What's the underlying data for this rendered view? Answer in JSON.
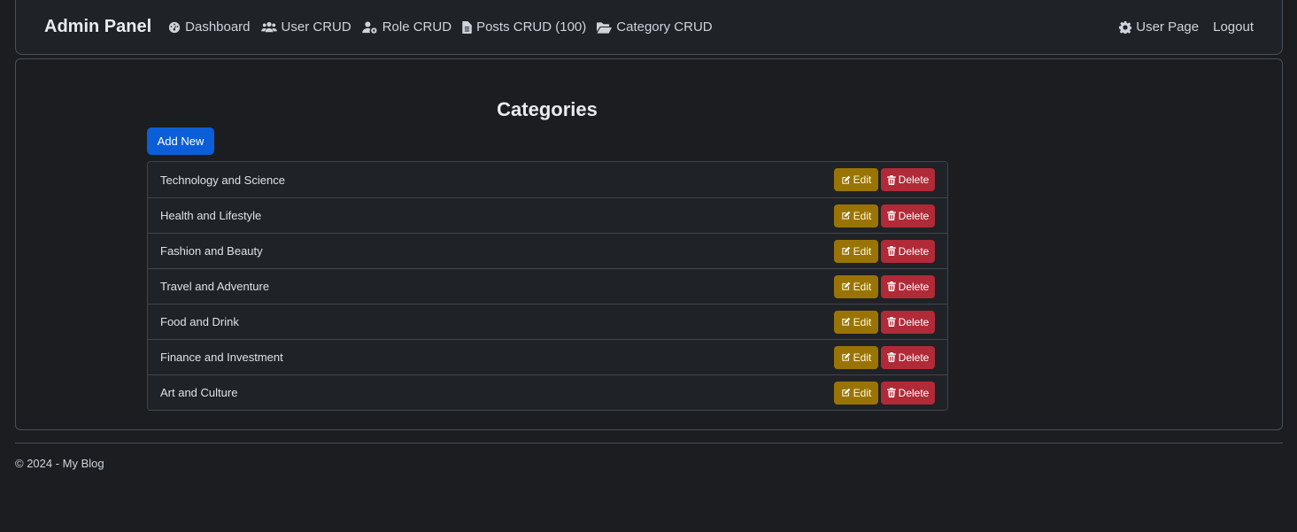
{
  "nav": {
    "brand": "Admin Panel",
    "links": [
      {
        "label": "Dashboard",
        "icon": "dashboard-icon"
      },
      {
        "label": "User CRUD",
        "icon": "users-icon"
      },
      {
        "label": "Role CRUD",
        "icon": "user-gear-icon"
      },
      {
        "label": "Posts CRUD (100)",
        "icon": "file-icon"
      },
      {
        "label": "Category CRUD",
        "icon": "folder-open-icon"
      }
    ],
    "right": [
      {
        "label": "User Page",
        "icon": "gear-icon"
      },
      {
        "label": "Logout"
      }
    ]
  },
  "main": {
    "title": "Categories",
    "add_label": "Add New",
    "edit_label": "Edit",
    "delete_label": "Delete",
    "categories": [
      "Technology and Science",
      "Health and Lifestyle",
      "Fashion and Beauty",
      "Travel and Adventure",
      "Food and Drink",
      "Finance and Investment",
      "Art and Culture"
    ]
  },
  "footer": {
    "text": "© 2024 - My Blog"
  },
  "colors": {
    "primary": "#0b5ed7",
    "warning": "#997404",
    "danger": "#b02a37"
  }
}
